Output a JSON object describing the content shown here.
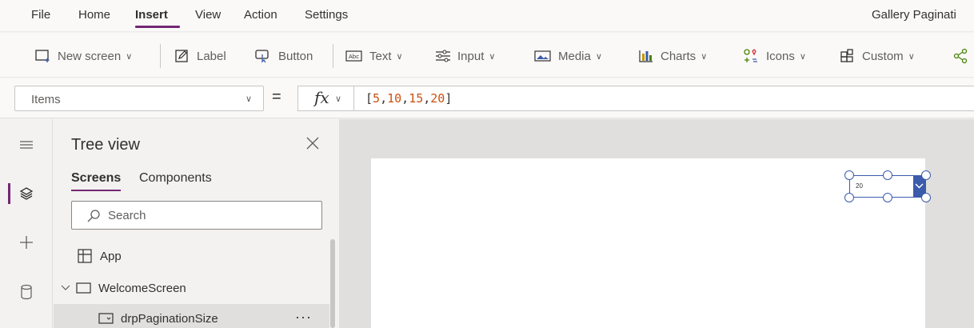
{
  "menu": {
    "items": [
      "File",
      "Home",
      "Insert",
      "View",
      "Action",
      "Settings"
    ],
    "active": "Insert",
    "app_title": "Gallery Paginati"
  },
  "ribbon": {
    "new_screen": "New screen",
    "label": "Label",
    "button": "Button",
    "text": "Text",
    "input": "Input",
    "media": "Media",
    "charts": "Charts",
    "icons": "Icons",
    "custom": "Custom"
  },
  "formula_bar": {
    "property": "Items",
    "equals": "=",
    "fx": "fx",
    "formula_open": "[",
    "formula_values": [
      "5",
      "10",
      "15",
      "20"
    ],
    "formula_close": "]"
  },
  "tree_view": {
    "title": "Tree view",
    "tabs": [
      "Screens",
      "Components"
    ],
    "active_tab": "Screens",
    "search_placeholder": "Search",
    "items": [
      {
        "label": "App",
        "icon": "app-icon"
      },
      {
        "label": "WelcomeScreen",
        "icon": "screen-icon"
      },
      {
        "label": "drpPaginationSize",
        "icon": "dropdown-icon"
      }
    ],
    "more": "···"
  },
  "canvas": {
    "dropdown_value": "20"
  },
  "colors": {
    "accent": "#742774",
    "selection": "#3b5bab",
    "number_literal": "#ca5010"
  }
}
